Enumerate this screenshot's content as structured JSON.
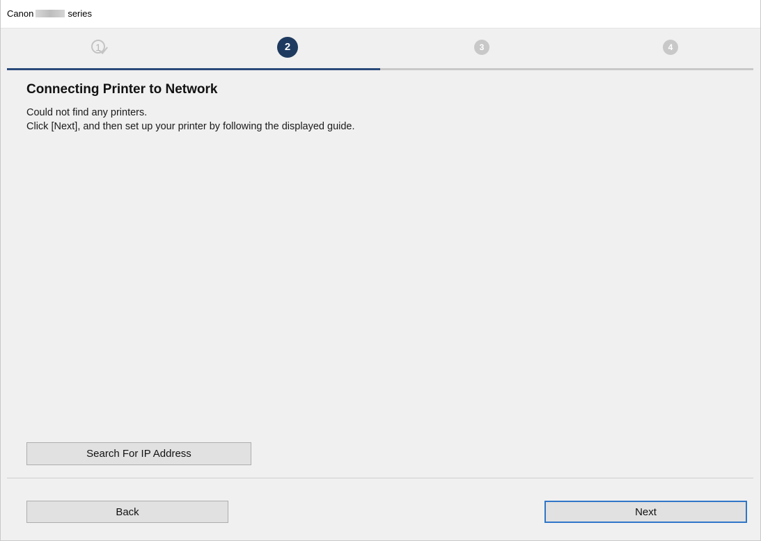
{
  "window": {
    "title_prefix": "Canon",
    "title_suffix": "series"
  },
  "steps": [
    {
      "number": "1",
      "state": "completed",
      "icon": "check-icon"
    },
    {
      "number": "2",
      "state": "current"
    },
    {
      "number": "3",
      "state": "upcoming"
    },
    {
      "number": "4",
      "state": "upcoming"
    }
  ],
  "progress": {
    "current_step": 2,
    "total_steps": 4,
    "fraction_complete": 0.5
  },
  "colors": {
    "current_step": "#1e3a5f",
    "progress_fill": "#2b4a7a",
    "default_button_border": "#2f76c8"
  },
  "content": {
    "heading": "Connecting Printer to Network",
    "message_lines": [
      "Could not find any printers.",
      "Click [Next], and then set up your printer by following the displayed guide."
    ]
  },
  "buttons": {
    "search_ip": "Search For IP Address",
    "back": "Back",
    "next": "Next"
  }
}
